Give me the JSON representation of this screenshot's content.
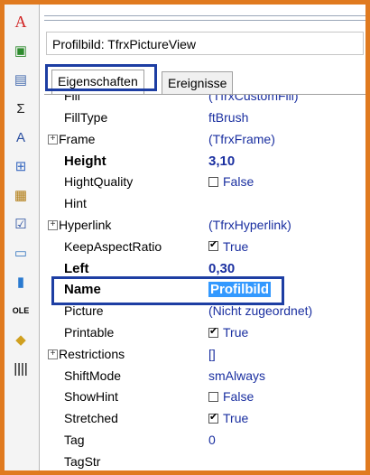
{
  "toolbar": {
    "icons": [
      {
        "name": "text-icon",
        "glyph": "A",
        "color": "#d02020"
      },
      {
        "name": "picture-icon",
        "glyph": "▣",
        "color": "#2e8b2e"
      },
      {
        "name": "memo-icon",
        "glyph": "▤",
        "color": "#4a6fb0"
      },
      {
        "name": "sum-icon",
        "glyph": "Σ",
        "color": "#222222"
      },
      {
        "name": "system-text-icon",
        "glyph": "A",
        "color": "#2a4fa0"
      },
      {
        "name": "subreport-icon",
        "glyph": "⊞",
        "color": "#3a6ac0"
      },
      {
        "name": "cross-tab-icon",
        "glyph": "▦",
        "color": "#b07a10"
      },
      {
        "name": "checkbox-icon",
        "glyph": "☑",
        "color": "#2a4fa0"
      },
      {
        "name": "line-icon",
        "glyph": "▭",
        "color": "#3a7ac0"
      },
      {
        "name": "chart-icon",
        "glyph": "▮",
        "color": "#2a7ad0"
      },
      {
        "name": "ole-icon",
        "glyph": "OLE",
        "color": "#000000"
      },
      {
        "name": "shape-icon",
        "glyph": "◆",
        "color": "#d0a020"
      },
      {
        "name": "barcode-icon",
        "glyph": "||||",
        "color": "#000000"
      }
    ]
  },
  "inspector": {
    "selector_value": "Profilbild: TfrxPictureView",
    "tabs": [
      {
        "label": "Eigenschaften",
        "active": true
      },
      {
        "label": "Ereignisse",
        "active": false
      }
    ],
    "partial_top_row": {
      "name": "Fill",
      "value": "(TfrxCustomFill)"
    },
    "properties": [
      {
        "name": "FillType",
        "value": "ftBrush",
        "expandable": false,
        "bold": false,
        "checkbox": null
      },
      {
        "name": "Frame",
        "value": "(TfrxFrame)",
        "expandable": true,
        "bold": false,
        "checkbox": null
      },
      {
        "name": "Height",
        "value": "3,10",
        "expandable": false,
        "bold": true,
        "checkbox": null
      },
      {
        "name": "HightQuality",
        "value": "False",
        "expandable": false,
        "bold": false,
        "checkbox": "unchecked"
      },
      {
        "name": "Hint",
        "value": "",
        "expandable": false,
        "bold": false,
        "checkbox": null
      },
      {
        "name": "Hyperlink",
        "value": "(TfrxHyperlink)",
        "expandable": true,
        "bold": false,
        "checkbox": null
      },
      {
        "name": "KeepAspectRatio",
        "value": "True",
        "expandable": false,
        "bold": false,
        "checkbox": "checked"
      },
      {
        "name": "Left",
        "value": "0,30",
        "expandable": false,
        "bold": true,
        "checkbox": null
      },
      {
        "name": "Name",
        "value": "Profilbild",
        "expandable": false,
        "bold": true,
        "checkbox": null,
        "selected": true
      },
      {
        "name": "Picture",
        "value": "(Nicht zugeordnet)",
        "expandable": false,
        "bold": false,
        "checkbox": null
      },
      {
        "name": "Printable",
        "value": "True",
        "expandable": false,
        "bold": false,
        "checkbox": "checked"
      },
      {
        "name": "Restrictions",
        "value": "[]",
        "expandable": true,
        "bold": false,
        "checkbox": null
      },
      {
        "name": "ShiftMode",
        "value": "smAlways",
        "expandable": false,
        "bold": false,
        "checkbox": null
      },
      {
        "name": "ShowHint",
        "value": "False",
        "expandable": false,
        "bold": false,
        "checkbox": "unchecked"
      },
      {
        "name": "Stretched",
        "value": "True",
        "expandable": false,
        "bold": false,
        "checkbox": "checked"
      },
      {
        "name": "Tag",
        "value": "0",
        "expandable": false,
        "bold": false,
        "checkbox": null
      },
      {
        "name": "TagStr",
        "value": "",
        "expandable": false,
        "bold": false,
        "checkbox": null
      }
    ]
  },
  "colors": {
    "background": "#e07a1f",
    "highlight_border": "#1d3ea3",
    "value_text": "#1a2fa0",
    "selection": "#3399ff"
  }
}
